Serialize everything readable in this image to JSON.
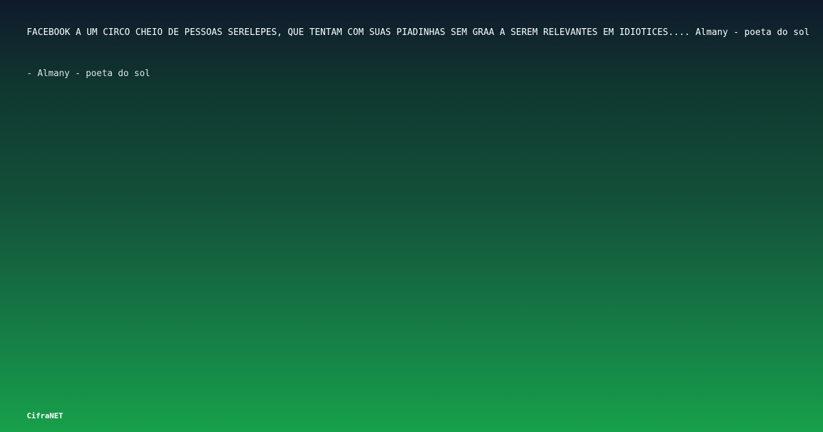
{
  "quote": {
    "text": "FACEBOOK Ã  UM CIRCO CHEIO DE PESSOAS SERELEPES, QUE TENTAM COM SUAS PIADINHAS SEM GRAÃ A SEREM RELEVANTES EM IDIOTICES.... Almany - poeta do sol",
    "author_line": "- Almany - poeta do sol"
  },
  "brand": {
    "name": "CifraNET"
  }
}
